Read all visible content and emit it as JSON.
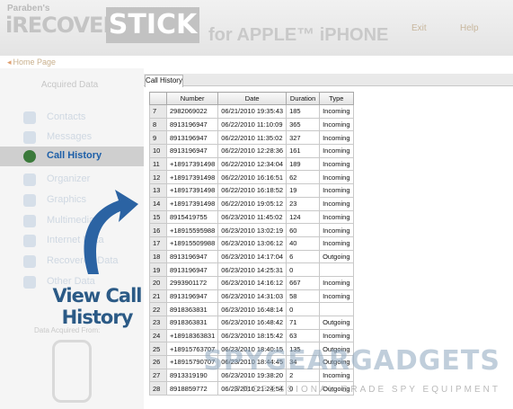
{
  "header": {
    "brand_small": "Paraben's",
    "brand_main": "iRECOVERY",
    "brand_stick": "STICK",
    "brand_sub": "for APPLE™ iPHONE",
    "links": [
      "Exit",
      "Help"
    ]
  },
  "homepage_link": "Home Page",
  "sidebar": {
    "title": "Acquired Data",
    "items": [
      {
        "label": "Contacts",
        "icon": "contacts-icon"
      },
      {
        "label": "Messages",
        "icon": "messages-icon"
      },
      {
        "label": "Call History",
        "icon": "call-history-icon"
      },
      {
        "label": "Organizer",
        "icon": "organizer-icon"
      },
      {
        "label": "Graphics",
        "icon": "graphics-icon"
      },
      {
        "label": "Multimedia",
        "icon": "multimedia-icon"
      },
      {
        "label": "Internet Data",
        "icon": "internet-icon"
      },
      {
        "label": "Recovered Data",
        "icon": "recovered-icon"
      },
      {
        "label": "Other Data",
        "icon": "other-data-icon"
      }
    ],
    "data_from": "Data Acquired From:"
  },
  "callout": {
    "line1": "View Call",
    "line2": "History"
  },
  "tab": {
    "label": "Call History"
  },
  "table": {
    "columns": [
      "Number",
      "Date",
      "Duration",
      "Type"
    ],
    "rows": [
      [
        "7",
        "2982069022",
        "06/21/2010 19:35:43",
        "185",
        "Incoming"
      ],
      [
        "8",
        "8913196947",
        "06/22/2010 11:10:09",
        "365",
        "Incoming"
      ],
      [
        "9",
        "8913196947",
        "06/22/2010 11:35:02",
        "327",
        "Incoming"
      ],
      [
        "10",
        "8913196947",
        "06/22/2010 12:28:36",
        "161",
        "Incoming"
      ],
      [
        "11",
        "+18917391498",
        "06/22/2010 12:34:04",
        "189",
        "Incoming"
      ],
      [
        "12",
        "+18917391498",
        "06/22/2010 16:16:51",
        "62",
        "Incoming"
      ],
      [
        "13",
        "+18917391498",
        "06/22/2010 16:18:52",
        "19",
        "Incoming"
      ],
      [
        "14",
        "+18917391498",
        "06/22/2010 19:05:12",
        "23",
        "Incoming"
      ],
      [
        "15",
        "8915419755",
        "06/23/2010 11:45:02",
        "124",
        "Incoming"
      ],
      [
        "16",
        "+18915595988",
        "06/23/2010 13:02:19",
        "60",
        "Incoming"
      ],
      [
        "17",
        "+18915509988",
        "06/23/2010 13:06:12",
        "40",
        "Incoming"
      ],
      [
        "18",
        "8913196947",
        "06/23/2010 14:17:04",
        "6",
        "Outgoing"
      ],
      [
        "19",
        "8913196947",
        "06/23/2010 14:25:31",
        "0",
        ""
      ],
      [
        "20",
        "2993901172",
        "06/23/2010 14:16:12",
        "667",
        "Incoming"
      ],
      [
        "21",
        "8913196947",
        "06/23/2010 14:31:03",
        "58",
        "Incoming"
      ],
      [
        "22",
        "8918363831",
        "06/23/2010 16:48:14",
        "0",
        ""
      ],
      [
        "23",
        "8918363831",
        "06/23/2010 16:48:42",
        "71",
        "Outgoing"
      ],
      [
        "24",
        "+18918363831",
        "06/23/2010 18:15:42",
        "63",
        "Incoming"
      ],
      [
        "25",
        "+18915763707",
        "06/23/2010 18:40:15",
        "135",
        "Outgoing"
      ],
      [
        "26",
        "+18915790707",
        "06/23/2010 18:44:45",
        "34",
        "Outgoing"
      ],
      [
        "27",
        "8913319190",
        "06/23/2010 19:38:20",
        "2",
        "Incoming"
      ],
      [
        "28",
        "8918859772",
        "06/23/2010 21:24:54",
        "0",
        "Outgoing"
      ]
    ]
  },
  "watermark": {
    "text": "SPYGEARGADGETS",
    "tagline": "PROFESSIONAL GRADE SPY EQUIPMENT"
  },
  "colors": {
    "accent": "#1d5fa8",
    "callout": "#2b5a86",
    "active_icon": "#3b7a3b"
  }
}
